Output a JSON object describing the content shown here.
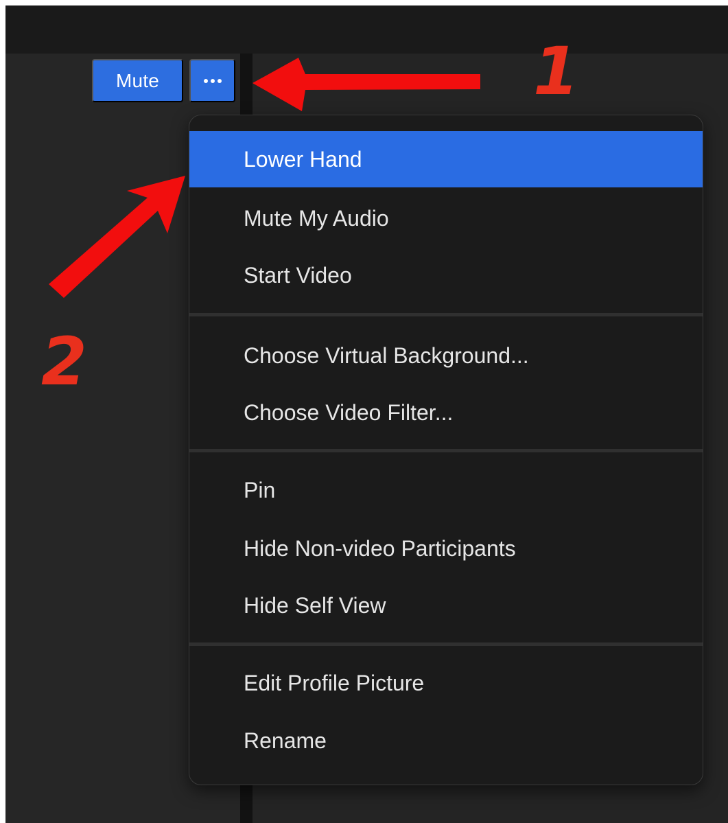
{
  "controls": {
    "mute_label": "Mute",
    "more_icon": "ellipsis-icon"
  },
  "menu": {
    "items": [
      {
        "label": "Lower Hand",
        "highlighted": true
      },
      {
        "label": "Mute My Audio"
      },
      {
        "label": "Start Video"
      },
      {
        "label": "Choose Virtual Background..."
      },
      {
        "label": "Choose Video Filter..."
      },
      {
        "label": "Pin"
      },
      {
        "label": "Hide Non-video Participants"
      },
      {
        "label": "Hide Self View"
      },
      {
        "label": "Edit Profile Picture"
      },
      {
        "label": "Rename"
      }
    ]
  },
  "annotations": {
    "step_1": "1",
    "step_2": "2",
    "arrow_color": "#f20e0e",
    "number_color": "#e9301d"
  },
  "colors": {
    "accent": "#2d6ee0",
    "highlight": "#2a6ce3",
    "menu_bg": "#1b1b1b"
  }
}
